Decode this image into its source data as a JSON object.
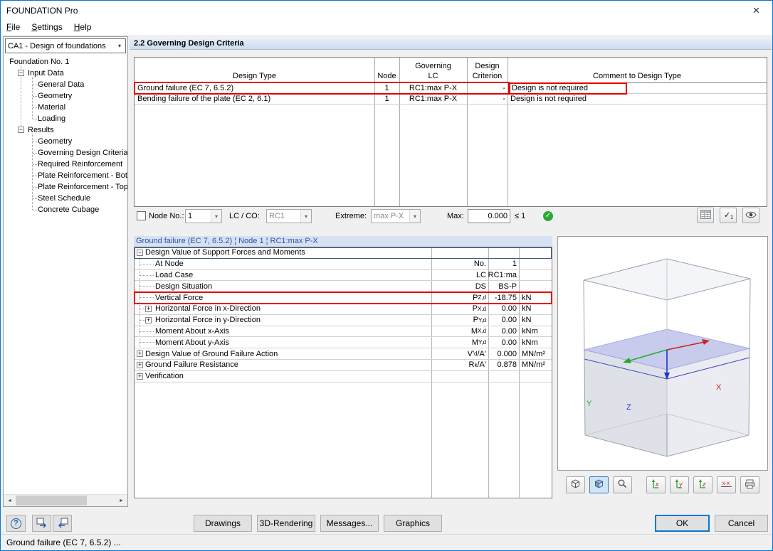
{
  "icons": {
    "close": "×",
    "combo_arrow": "▾",
    "scroll_left": "◄",
    "scroll_right": "►",
    "check": "✓",
    "plus": "+",
    "minus": "−",
    "help": "?"
  },
  "window": {
    "title": "FOUNDATION Pro"
  },
  "menu": {
    "items": [
      {
        "label": "File"
      },
      {
        "label": "Settings"
      },
      {
        "label": "Help"
      }
    ]
  },
  "sidebar": {
    "case_selector": {
      "value": "CA1 - Design of foundations"
    },
    "tree": [
      {
        "level": 0,
        "label": "Foundation No. 1"
      },
      {
        "level": 1,
        "expander": "minus",
        "label": "Input Data"
      },
      {
        "level": 2,
        "label": "General Data"
      },
      {
        "level": 2,
        "label": "Geometry"
      },
      {
        "level": 2,
        "label": "Material"
      },
      {
        "level": 2,
        "label": "Loading"
      },
      {
        "level": 1,
        "expander": "minus",
        "label": "Results"
      },
      {
        "level": 2,
        "label": "Geometry"
      },
      {
        "level": 2,
        "label": "Governing Design Criteria"
      },
      {
        "level": 2,
        "label": "Required Reinforcement"
      },
      {
        "level": 2,
        "label": "Plate Reinforcement - Bottom"
      },
      {
        "level": 2,
        "label": "Plate Reinforcement - Top"
      },
      {
        "level": 2,
        "label": "Steel Schedule"
      },
      {
        "level": 2,
        "label": "Concrete Cubage"
      }
    ]
  },
  "main": {
    "section_title": "2.2 Governing Design Criteria",
    "criteria_table": {
      "headers": {
        "design_type": "Design Type",
        "node": "Node",
        "governing_top": "Governing",
        "governing_bottom": "LC",
        "criterion_top": "Design",
        "criterion_bottom": "Criterion",
        "comment": "Comment to Design Type"
      },
      "rows": [
        {
          "design_type": "Ground failure (EC 7, 6.5.2)",
          "node": "1",
          "governing_lc": "RC1:max P-X",
          "criterion": "-",
          "comment": "Design is not required",
          "row_highlight": true,
          "comment_highlight": true
        },
        {
          "design_type": "Bending failure of the plate (EC 2, 6.1)",
          "node": "1",
          "governing_lc": "RC1:max P-X",
          "criterion": "-",
          "comment": "Design is not required",
          "row_highlight": false,
          "comment_highlight": false
        }
      ]
    },
    "filter": {
      "node_label": "Node No.:",
      "node_checked": false,
      "node_value": "1",
      "lc_label": "LC / CO:",
      "lc_value": "RC1",
      "extreme_label": "Extreme:",
      "extreme_value": "max P-X",
      "max_label": "Max:",
      "max_value": "0.000",
      "max_limit": "≤ 1",
      "buttons": [
        {
          "icon": "result-table",
          "name": "result-table-button"
        },
        {
          "icon": "check-one",
          "name": "check-criterion-button"
        },
        {
          "icon": "eye",
          "name": "visibility-button"
        }
      ]
    },
    "detail": {
      "title": "Ground failure (EC 7, 6.5.2) ¦ Node 1 ¦ RC1:max P-X",
      "rows": [
        {
          "level": 0,
          "expander": "minus",
          "label": "Design Value of Support Forces and Moments",
          "sym": [],
          "value": "",
          "unit": "",
          "focus": true
        },
        {
          "level": 1,
          "label": "At Node",
          "sym": [
            {
              "t": "No."
            }
          ],
          "value": "1",
          "unit": ""
        },
        {
          "level": 1,
          "label": "Load Case",
          "sym": [
            {
              "t": "LC"
            }
          ],
          "value": "RC1:ma",
          "unit": ""
        },
        {
          "level": 1,
          "label": "Design Situation",
          "sym": [
            {
              "t": "DS"
            }
          ],
          "value": "BS-P",
          "unit": ""
        },
        {
          "level": 1,
          "label": "Vertical Force",
          "sym": [
            {
              "t": "P"
            },
            {
              "s": "Z,d"
            }
          ],
          "value": "-18.75",
          "unit": "kN",
          "highlight": true
        },
        {
          "level": 1,
          "expander": "plus",
          "label": "Horizontal Force in x-Direction",
          "sym": [
            {
              "t": "P"
            },
            {
              "s": "X,d"
            }
          ],
          "value": "0.00",
          "unit": "kN"
        },
        {
          "level": 1,
          "expander": "plus",
          "label": "Horizontal Force in y-Direction",
          "sym": [
            {
              "t": "P"
            },
            {
              "s": "Y,d"
            }
          ],
          "value": "0.00",
          "unit": "kN"
        },
        {
          "level": 1,
          "label": "Moment About x-Axis",
          "sym": [
            {
              "t": "M"
            },
            {
              "s": "X,d"
            }
          ],
          "value": "0.00",
          "unit": "kNm"
        },
        {
          "level": 1,
          "label": "Moment About y-Axis",
          "sym": [
            {
              "t": "M"
            },
            {
              "s": "Y,d"
            }
          ],
          "value": "0.00",
          "unit": "kNm"
        },
        {
          "level": 0,
          "expander": "plus",
          "label": "Design Value of Ground Failure Action",
          "sym": [
            {
              "t": "V'"
            },
            {
              "s": "d"
            },
            {
              "t": "/A'"
            }
          ],
          "value": "0.000",
          "unit": "MN/m²"
        },
        {
          "level": 0,
          "expander": "plus",
          "label": "Ground Failure Resistance",
          "sym": [
            {
              "t": "R"
            },
            {
              "s": "k"
            },
            {
              "t": "/A'"
            }
          ],
          "value": "0.878",
          "unit": "MN/m²"
        },
        {
          "level": 0,
          "expander": "plus",
          "label": "Verification",
          "sym": [],
          "value": "",
          "unit": ""
        }
      ]
    }
  },
  "viewport": {
    "axis_labels": {
      "x": "X",
      "y": "Y",
      "z": "Z"
    },
    "toolbar": [
      {
        "icon": "wireframe-box",
        "name": "view-wireframe-button"
      },
      {
        "icon": "solid-box",
        "name": "view-solid-button",
        "pressed": true
      },
      {
        "icon": "zoom-cursor",
        "name": "zoom-button"
      },
      {
        "icon": "axis",
        "label": "x",
        "name": "view-in-x-button"
      },
      {
        "icon": "axis",
        "label": "y",
        "name": "view-in-y-button"
      },
      {
        "icon": "axis",
        "label": "z",
        "name": "view-in-z-button"
      },
      {
        "icon": "section",
        "label": "x-x",
        "name": "section-view-button"
      },
      {
        "icon": "printer",
        "name": "print-graphic-button"
      }
    ]
  },
  "footer": {
    "buttons": [
      {
        "label": "Drawings"
      },
      {
        "label": "3D-Rendering"
      },
      {
        "label": "Messages..."
      },
      {
        "label": "Graphics"
      }
    ],
    "ok": "OK",
    "cancel": "Cancel"
  },
  "status_bar": {
    "text": "Ground failure (EC 7, 6.5.2) ..."
  }
}
